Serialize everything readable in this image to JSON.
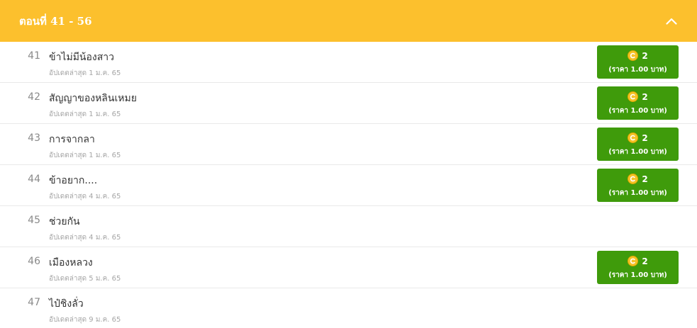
{
  "header": {
    "title": "ตอนที่ 41 - 56",
    "collapse_icon": "chevron-up-icon"
  },
  "colors": {
    "header_bg": "#fcc02d",
    "buy_button_bg": "#3f9b0b",
    "coin": "#f5c227"
  },
  "episodes": [
    {
      "number": "41",
      "title": "ข้าไม่มีน้องสาว",
      "updated": "อัปเดตล่าสุด 1 ม.ค. 65",
      "paid": true,
      "coins": "2",
      "price": "(ราคา 1.00 บาท)"
    },
    {
      "number": "42",
      "title": "สัญญาของหลินเหมย",
      "updated": "อัปเดตล่าสุด 1 ม.ค. 65",
      "paid": true,
      "coins": "2",
      "price": "(ราคา 1.00 บาท)"
    },
    {
      "number": "43",
      "title": "การจากลา",
      "updated": "อัปเดตล่าสุด 1 ม.ค. 65",
      "paid": true,
      "coins": "2",
      "price": "(ราคา 1.00 บาท)"
    },
    {
      "number": "44",
      "title": "ข้าอยาก....",
      "updated": "อัปเดตล่าสุด 4 ม.ค. 65",
      "paid": true,
      "coins": "2",
      "price": "(ราคา 1.00 บาท)"
    },
    {
      "number": "45",
      "title": "ช่วยกัน",
      "updated": "อัปเดตล่าสุด 4 ม.ค. 65",
      "paid": false
    },
    {
      "number": "46",
      "title": "เมืองหลวง",
      "updated": "อัปเดตล่าสุด 5 ม.ค. 65",
      "paid": true,
      "coins": "2",
      "price": "(ราคา 1.00 บาท)"
    },
    {
      "number": "47",
      "title": "ไป๋ชิงลั่ว",
      "updated": "อัปเดตล่าสุด 9 ม.ค. 65",
      "paid": false
    }
  ]
}
